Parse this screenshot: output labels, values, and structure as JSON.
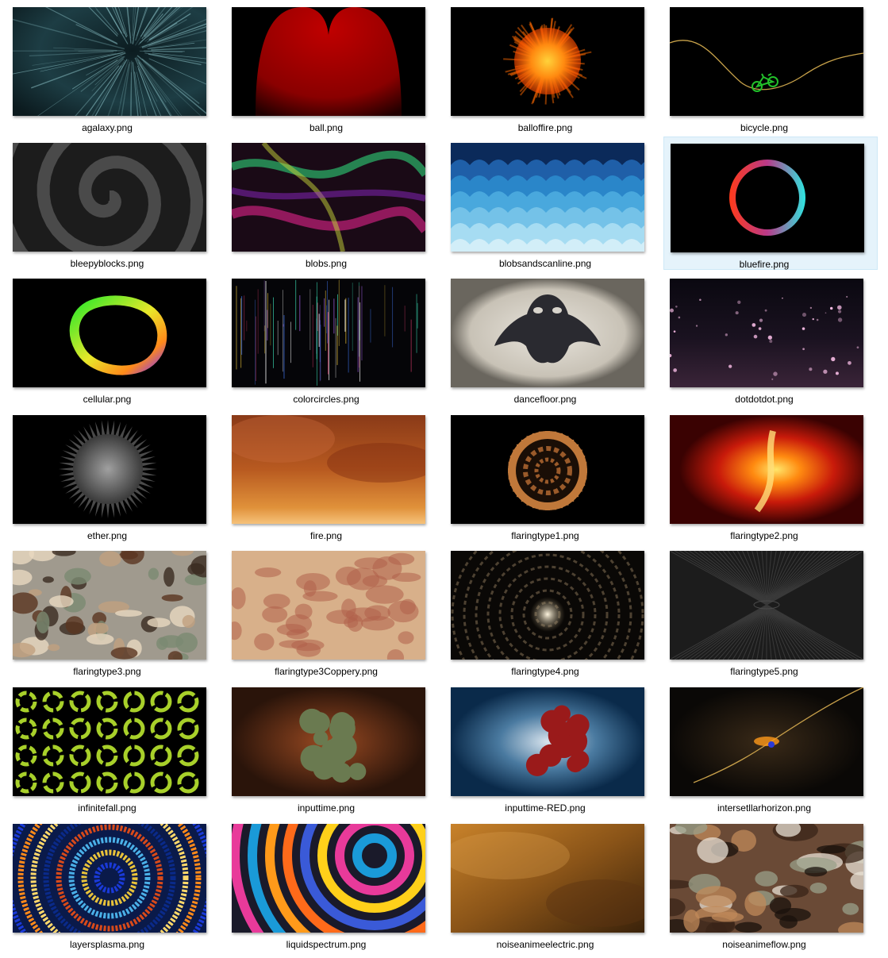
{
  "files": [
    {
      "name": "agalaxy.png",
      "thumb": "agalaxy",
      "selected": false
    },
    {
      "name": "ball.png",
      "thumb": "ball",
      "selected": false
    },
    {
      "name": "balloffire.png",
      "thumb": "balloffire",
      "selected": false
    },
    {
      "name": "bicycle.png",
      "thumb": "bicycle",
      "selected": false
    },
    {
      "name": "bleepyblocks.png",
      "thumb": "bleepyblocks",
      "selected": false
    },
    {
      "name": "blobs.png",
      "thumb": "blobs",
      "selected": false
    },
    {
      "name": "blobsandscanline.png",
      "thumb": "blobsandscanline",
      "selected": false
    },
    {
      "name": "bluefire.png",
      "thumb": "bluefire",
      "selected": true
    },
    {
      "name": "cellular.png",
      "thumb": "cellular",
      "selected": false
    },
    {
      "name": "colorcircles.png",
      "thumb": "colorcircles",
      "selected": false
    },
    {
      "name": "dancefloor.png",
      "thumb": "dancefloor",
      "selected": false
    },
    {
      "name": "dotdotdot.png",
      "thumb": "dotdotdot",
      "selected": false
    },
    {
      "name": "ether.png",
      "thumb": "ether",
      "selected": false
    },
    {
      "name": "fire.png",
      "thumb": "fire",
      "selected": false
    },
    {
      "name": "flaringtype1.png",
      "thumb": "flaringtype1",
      "selected": false
    },
    {
      "name": "flaringtype2.png",
      "thumb": "flaringtype2",
      "selected": false
    },
    {
      "name": "flaringtype3.png",
      "thumb": "flaringtype3",
      "selected": false
    },
    {
      "name": "flaringtype3Coppery.png",
      "thumb": "flaringtype3Coppery",
      "selected": false
    },
    {
      "name": "flaringtype4.png",
      "thumb": "flaringtype4",
      "selected": false
    },
    {
      "name": "flaringtype5.png",
      "thumb": "flaringtype5",
      "selected": false
    },
    {
      "name": "infinitefall.png",
      "thumb": "infinitefall",
      "selected": false
    },
    {
      "name": "inputtime.png",
      "thumb": "inputtime",
      "selected": false
    },
    {
      "name": "inputtime-RED.png",
      "thumb": "inputtimeRED",
      "selected": false
    },
    {
      "name": "intersetllarhorizon.png",
      "thumb": "intersetllarhorizon",
      "selected": false
    },
    {
      "name": "layersplasma.png",
      "thumb": "layersplasma",
      "selected": false
    },
    {
      "name": "liquidspectrum.png",
      "thumb": "liquidspectrum",
      "selected": false
    },
    {
      "name": "noiseanimeelectric.png",
      "thumb": "noiseanimeelectric",
      "selected": false
    },
    {
      "name": "noiseanimeflow.png",
      "thumb": "noiseanimeflow",
      "selected": false
    }
  ]
}
